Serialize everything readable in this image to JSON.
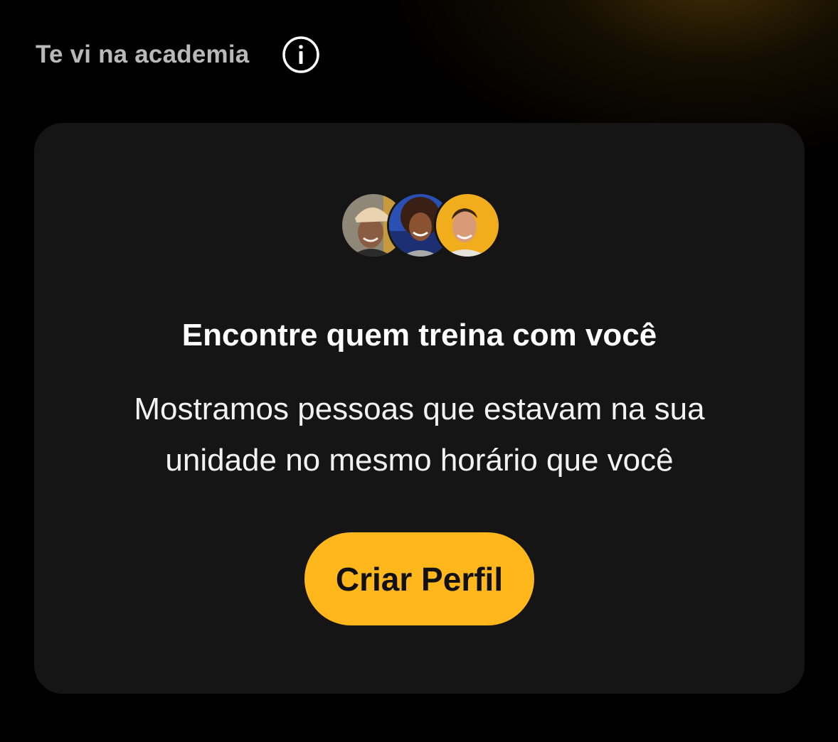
{
  "header": {
    "title": "Te vi na academia",
    "info_icon": "info-circle-icon"
  },
  "card": {
    "avatars": [
      {
        "name": "avatar-woman-cap",
        "icon": "person-photo"
      },
      {
        "name": "avatar-woman-curly",
        "icon": "person-photo"
      },
      {
        "name": "avatar-man",
        "icon": "person-photo"
      }
    ],
    "title": "Encontre quem treina com você",
    "description_line1": "Mostramos pessoas que estavam na sua",
    "description_line2": "unidade no mesmo horário que você",
    "cta_label": "Criar Perfil"
  },
  "colors": {
    "background": "#000000",
    "card": "#151515",
    "accent": "#ffb71b",
    "header_text": "#b9b9b9"
  }
}
